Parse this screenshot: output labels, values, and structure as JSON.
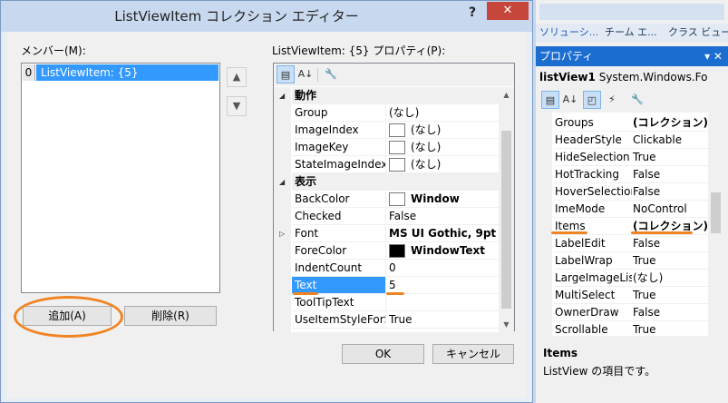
{
  "dialog": {
    "title": "ListViewItem コレクション エディター",
    "help_label": "?",
    "close_label": "✕",
    "members_label": "メンバー(M):",
    "members": [
      {
        "index": "0",
        "text": "ListViewItem: {5}"
      }
    ],
    "up_label": "▲",
    "down_label": "▼",
    "add_label": "追加(A)",
    "remove_label": "削除(R)",
    "properties_label": "ListViewItem: {5} プロパティ(P):",
    "ok_label": "OK",
    "cancel_label": "キャンセル",
    "property_rows": [
      {
        "kind": "cat",
        "name": "動作"
      },
      {
        "kind": "prop",
        "name": "Group",
        "value": "(なし)"
      },
      {
        "kind": "prop",
        "name": "ImageIndex",
        "value": "(なし)",
        "swatch": "#ffffff"
      },
      {
        "kind": "prop",
        "name": "ImageKey",
        "value": "(なし)",
        "swatch": "#ffffff"
      },
      {
        "kind": "prop",
        "name": "StateImageIndex",
        "value": "(なし)",
        "swatch": "#ffffff"
      },
      {
        "kind": "cat",
        "name": "表示"
      },
      {
        "kind": "prop",
        "name": "BackColor",
        "value": "Window",
        "swatch": "#ffffff",
        "bold": true
      },
      {
        "kind": "prop",
        "name": "Checked",
        "value": "False"
      },
      {
        "kind": "prop",
        "name": "Font",
        "value": "MS UI Gothic, 9pt",
        "bold": true,
        "expandable": true
      },
      {
        "kind": "prop",
        "name": "ForeColor",
        "value": "WindowText",
        "swatch": "#000000",
        "bold": true
      },
      {
        "kind": "prop",
        "name": "IndentCount",
        "value": "0"
      },
      {
        "kind": "prop",
        "name": "Text",
        "value": "5",
        "selected": true
      },
      {
        "kind": "prop",
        "name": "ToolTipText",
        "value": ""
      },
      {
        "kind": "prop",
        "name": "UseItemStyleForSubItems",
        "value": "True"
      }
    ]
  },
  "right_panel": {
    "tabs": [
      "ソリューシ...",
      "チーム エ...",
      "クラス ビュー"
    ],
    "header": "プロパティ",
    "pin_label": "▾ ✕",
    "object_name": "listView1",
    "object_type": "System.Windows.Fo",
    "properties": [
      {
        "name": "Groups",
        "value": "(コレクション)",
        "bold": true
      },
      {
        "name": "HeaderStyle",
        "value": "Clickable"
      },
      {
        "name": "HideSelection",
        "value": "True"
      },
      {
        "name": "HotTracking",
        "value": "False"
      },
      {
        "name": "HoverSelection",
        "value": "False"
      },
      {
        "name": "ImeMode",
        "value": "NoControl"
      },
      {
        "name": "Items",
        "value": "(コレクション)",
        "bold": true,
        "underline": true
      },
      {
        "name": "LabelEdit",
        "value": "False"
      },
      {
        "name": "LabelWrap",
        "value": "True"
      },
      {
        "name": "LargeImageList",
        "value": "(なし)"
      },
      {
        "name": "MultiSelect",
        "value": "True"
      },
      {
        "name": "OwnerDraw",
        "value": "False"
      },
      {
        "name": "Scrollable",
        "value": "True"
      }
    ],
    "desc_title": "Items",
    "desc_text": "ListView の項目です。"
  },
  "colors": {
    "accent": "#3399ff",
    "highlight": "#f08422",
    "panel_header": "#1c6dd0"
  },
  "icons": [
    "categorized-icon",
    "alphabetical-icon",
    "property-pages-icon",
    "events-icon",
    "wrench-icon"
  ]
}
